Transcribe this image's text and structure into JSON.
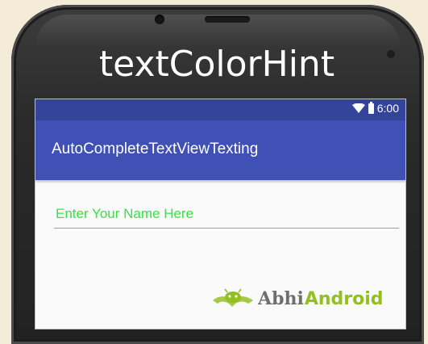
{
  "device": {
    "label": "textColorHint"
  },
  "status_bar": {
    "time": "6:00",
    "icons": [
      "wifi-icon",
      "battery-icon"
    ],
    "color": "#34449b"
  },
  "app_bar": {
    "title": "AutoCompleteTextViewTexting",
    "color": "#3f51b5"
  },
  "form": {
    "name_input": {
      "value": "",
      "placeholder": "Enter Your Name Here",
      "hint_color": "#33e63c"
    }
  },
  "watermark": {
    "brand_part1": "Abhi",
    "brand_part2": "Android",
    "icon": "android-logo-icon",
    "colors": {
      "part1": "#6f6f6f",
      "part2": "#93c020"
    }
  }
}
